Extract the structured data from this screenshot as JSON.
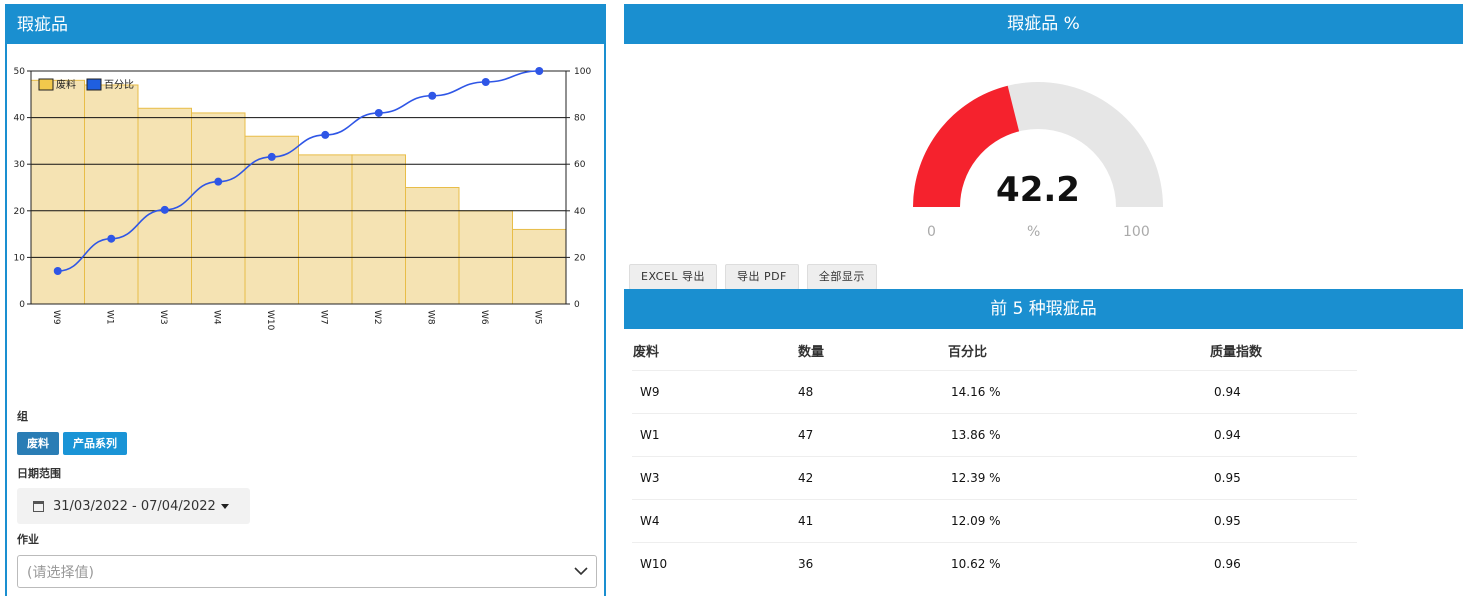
{
  "left_panel": {
    "title": "瑕疵品",
    "group_label": "组",
    "group_buttons": [
      "废料",
      "产品系列"
    ],
    "date_label": "日期范围",
    "date_range": "31/03/2022 - 07/04/2022",
    "job_label": "作业",
    "job_placeholder": "(请选择值)"
  },
  "chart_data": {
    "type": "bar",
    "categories": [
      "W9",
      "W1",
      "W3",
      "W4",
      "W10",
      "W7",
      "W2",
      "W8",
      "W6",
      "W5"
    ],
    "series": [
      {
        "name": "废料",
        "type": "bar",
        "axis": "left",
        "color": "#f5e3b3",
        "values": [
          48,
          47,
          42,
          41,
          36,
          32,
          32,
          25,
          20,
          16
        ]
      },
      {
        "name": "百分比",
        "type": "line",
        "axis": "right",
        "color": "#2f56e6",
        "values": [
          14.16,
          28.02,
          40.41,
          52.5,
          63.12,
          72.56,
          82.0,
          89.38,
          95.28,
          100
        ]
      }
    ],
    "y_left": {
      "range": [
        0,
        50
      ],
      "ticks": [
        "0",
        "10",
        "20",
        "30",
        "40",
        "50"
      ]
    },
    "y_right": {
      "range": [
        0,
        100
      ],
      "ticks": [
        "0",
        "20",
        "40",
        "60",
        "80",
        "100"
      ]
    },
    "grid": true,
    "legend": "top-left"
  },
  "gauge": {
    "title": "瑕疵品 %",
    "value": 42.2,
    "value_text": "42.2",
    "min_label": "0",
    "unit_label": "%",
    "max_label": "100",
    "fill_color": "#f5222d",
    "track_color": "#e6e6e6"
  },
  "export_buttons": [
    "EXCEL 导出",
    "导出 PDF",
    "全部显示"
  ],
  "top5": {
    "title": "前 5 种瑕疵品",
    "headers": [
      "废料",
      "数量",
      "百分比",
      "质量指数"
    ],
    "rows": [
      [
        "W9",
        "48",
        "14.16 %",
        "0.94"
      ],
      [
        "W1",
        "47",
        "13.86 %",
        "0.94"
      ],
      [
        "W3",
        "42",
        "12.39 %",
        "0.95"
      ],
      [
        "W4",
        "41",
        "12.09 %",
        "0.95"
      ],
      [
        "W10",
        "36",
        "10.62 %",
        "0.96"
      ]
    ]
  }
}
